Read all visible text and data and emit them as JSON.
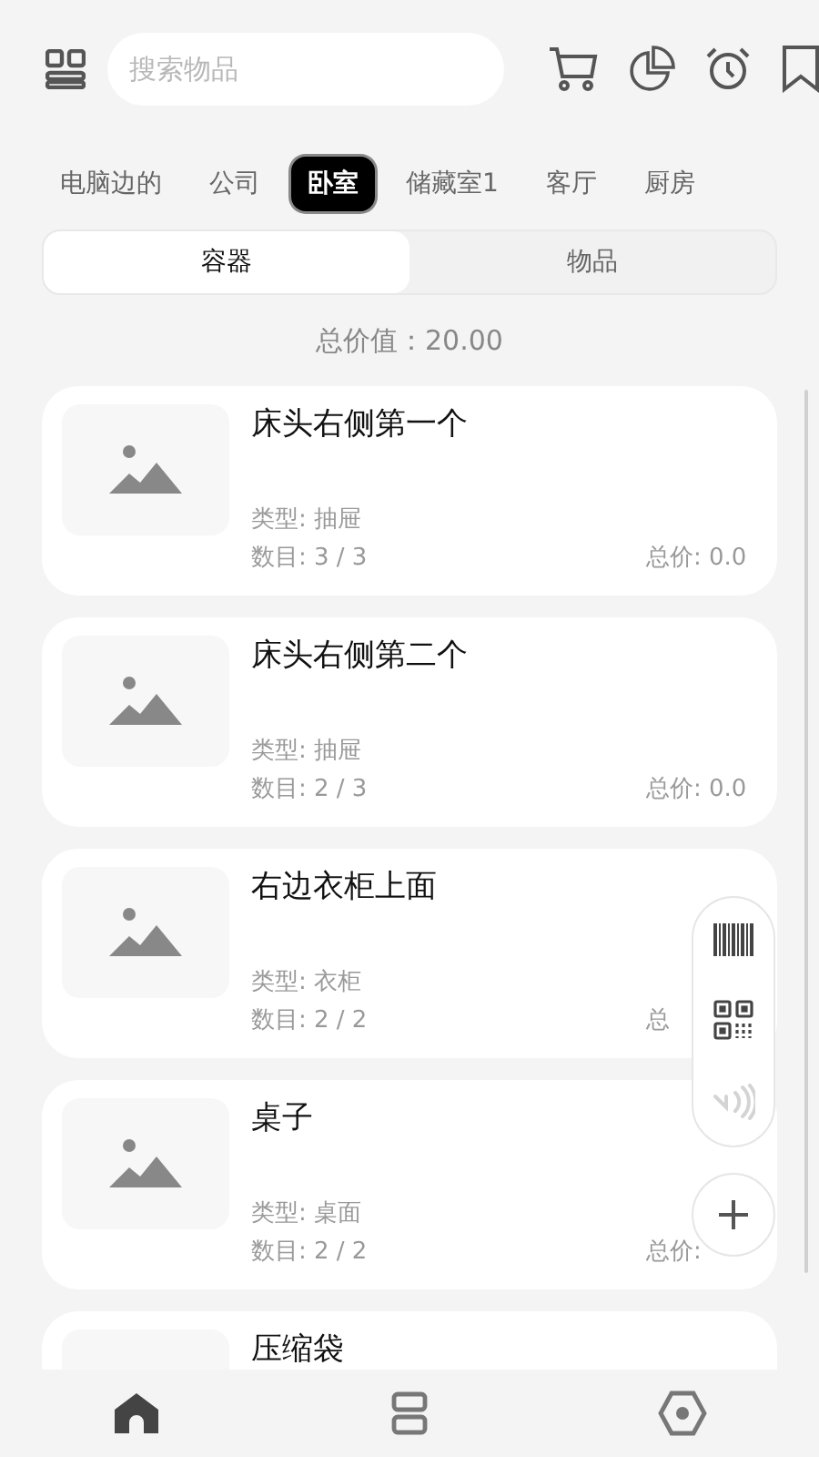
{
  "header": {
    "search": {
      "placeholder": "搜索物品"
    }
  },
  "locations": [
    {
      "label": "电脑边的",
      "selected": false
    },
    {
      "label": "公司",
      "selected": false
    },
    {
      "label": "卧室",
      "selected": true
    },
    {
      "label": "储藏室1",
      "selected": false
    },
    {
      "label": "客厅",
      "selected": false
    },
    {
      "label": "厨房",
      "selected": false
    }
  ],
  "segments": [
    {
      "label": "容器",
      "selected": true
    },
    {
      "label": "物品",
      "selected": false
    }
  ],
  "total": "总价值：20.00",
  "cards": [
    {
      "title": "床头右侧第一个",
      "type": "类型: 抽屉",
      "count": "数目: 3 / 3",
      "price": "总价: 0.0"
    },
    {
      "title": "床头右侧第二个",
      "type": "类型: 抽屉",
      "count": "数目: 2 / 3",
      "price": "总价: 0.0"
    },
    {
      "title": "右边衣柜上面",
      "type": "类型: 衣柜",
      "count": "数目: 2 / 2",
      "price": "总"
    },
    {
      "title": "桌子",
      "type": "类型: 桌面",
      "count": "数目: 2 / 2",
      "price": "总价:"
    },
    {
      "title": "压缩袋"
    }
  ],
  "scan_actions": [
    {
      "kind": "barcode",
      "disabled": false
    },
    {
      "kind": "qr",
      "disabled": false
    },
    {
      "kind": "nfc",
      "disabled": true
    }
  ],
  "nav": [
    {
      "kind": "home",
      "selected": true
    },
    {
      "kind": "list",
      "selected": false
    },
    {
      "kind": "settings",
      "selected": false
    }
  ]
}
